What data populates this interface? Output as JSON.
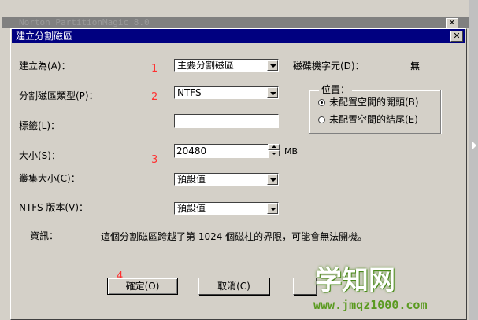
{
  "background_window": {
    "title": "Norton PartitionMagic 8.0"
  },
  "dialog": {
    "title": "建立分割磁區",
    "close_glyph": "✕",
    "create_as": {
      "label": "建立為(A)：",
      "value": "主要分割磁區"
    },
    "partition_type": {
      "label": "分割磁區類型(P)：",
      "value": "NTFS"
    },
    "tag": {
      "label": "標籤(L)：",
      "value": ""
    },
    "size": {
      "label": "大小(S)：",
      "value": "20480",
      "unit": "MB"
    },
    "cluster_size": {
      "label": "叢集大小(C)：",
      "value": "預設值"
    },
    "ntfs_version": {
      "label": "NTFS 版本(V)：",
      "value": "預設值"
    },
    "drive_letter": {
      "label": "磁碟機字元(D)：",
      "value": "無"
    },
    "position": {
      "title": "位置：",
      "options": [
        {
          "label": "未配置空間的開頭(B)",
          "checked": true
        },
        {
          "label": "未配置空間的結尾(E)",
          "checked": false
        }
      ]
    },
    "info": {
      "label": "資訊：",
      "text": "這個分割磁區跨越了第 1024 個磁柱的界限，可能會無法開機。"
    },
    "buttons": {
      "ok": "確定(O)",
      "cancel": "取消(C)"
    },
    "markers": [
      "1",
      "2",
      "3",
      "4"
    ]
  },
  "watermark": {
    "text": "学知网",
    "url": "www.jmqz1000.com"
  },
  "colors": {
    "titlebar": "#000080",
    "face": "#d4d0c8",
    "marker": "#ff3030",
    "watermark": "#5a9a20"
  }
}
